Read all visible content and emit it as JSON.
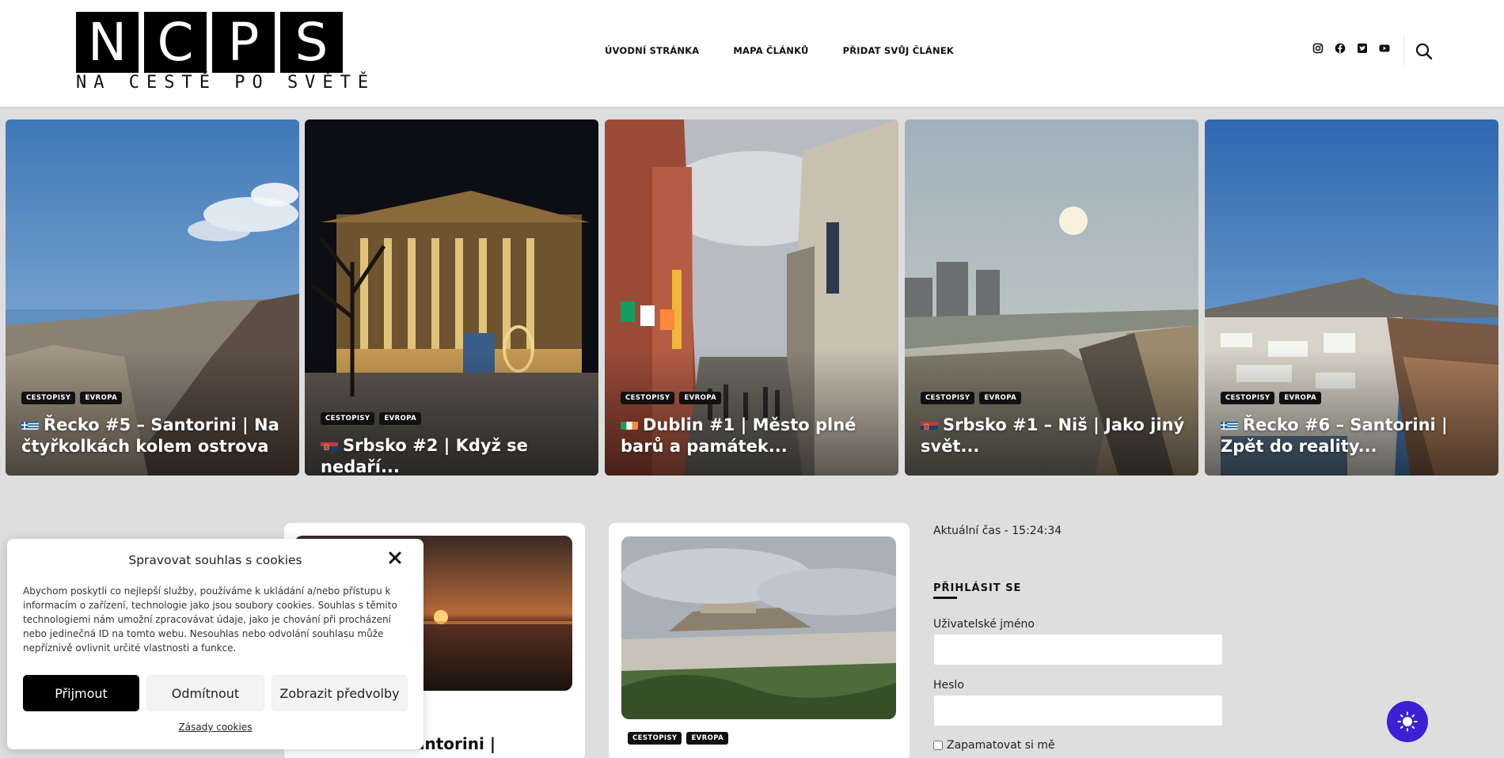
{
  "header": {
    "logo_letters": [
      "N",
      "C",
      "P",
      "S"
    ],
    "logo_subtitle": "NA CESTĚ PO SVĚTĚ",
    "nav": [
      {
        "label": "ÚVODNÍ STRÁNKA"
      },
      {
        "label": "MAPA ČLÁNKŮ"
      },
      {
        "label": "PŘIDAT SVŮJ ČLÁNEK"
      }
    ],
    "social_icons": [
      "instagram-icon",
      "facebook-icon",
      "twitter-icon",
      "youtube-icon"
    ]
  },
  "slider": [
    {
      "cats": [
        "CESTOPISY",
        "EVROPA"
      ],
      "flag": "greece",
      "title": "Řecko #5 – Santorini | Na čtyřkolkách kolem ostrova"
    },
    {
      "cats": [
        "CESTOPISY",
        "EVROPA"
      ],
      "flag": "serbia",
      "title": "Srbsko #2 | Když se nedaří..."
    },
    {
      "cats": [
        "CESTOPISY",
        "EVROPA"
      ],
      "flag": "ireland",
      "title": "Dublin #1 | Město plné barů a památek..."
    },
    {
      "cats": [
        "CESTOPISY",
        "EVROPA"
      ],
      "flag": "serbia",
      "title": "Srbsko #1 – Niš | Jako jiný svět..."
    },
    {
      "cats": [
        "CESTOPISY",
        "EVROPA"
      ],
      "flag": "greece",
      "title": "Řecko #6 – Santorini | Zpět do reality..."
    }
  ],
  "posts": [
    {
      "title_visible": "antorini |"
    },
    {
      "cats": [
        "CESTOPISY",
        "EVROPA"
      ]
    }
  ],
  "sidebar": {
    "clock": "Aktuální čas - 15:24:34",
    "login_title": "PŘIHLÁSIT SE",
    "username_label": "Uživatelské jméno",
    "password_label": "Heslo",
    "remember_label": "Zapamatovat si mě"
  },
  "cookie": {
    "title": "Spravovat souhlas s cookies",
    "text": "Abychom poskytli co nejlepší služby, používáme k ukládání a/nebo přístupu k informacím o zařízení, technologie jako jsou soubory cookies. Souhlas s těmito technologiemi nám umožní zpracovávat údaje, jako je chování při procházení nebo jedinečná ID na tomto webu. Nesouhlas nebo odvolání souhlasu může nepříznivě ovlivnit určité vlastnosti a funkce.",
    "accept": "Přijmout",
    "deny": "Odmítnout",
    "prefs": "Zobrazit předvolby",
    "policy_link": "Zásady cookies"
  },
  "colors": {
    "accent": "#3d1fd6",
    "tag_bg": "#111111",
    "page_bg": "#dedede"
  }
}
